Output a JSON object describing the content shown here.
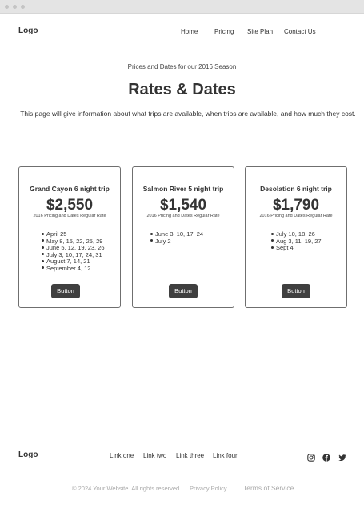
{
  "header": {
    "logo": "Logo",
    "nav": [
      {
        "label": "Home"
      },
      {
        "label": "Pricing"
      },
      {
        "label": "Site Plan"
      },
      {
        "label": "Contact Us"
      }
    ]
  },
  "hero": {
    "eyebrow": "Prices and Dates for our 2016 Season",
    "title": "Rates & Dates",
    "intro": "This page will give information about what trips are available, when trips are available, and how much they cost."
  },
  "cards": [
    {
      "title": "Grand Cayon 6 night trip",
      "price": "$2,550",
      "note": "2016 Pricing and Dates Regular Rate",
      "dates": [
        "April 25",
        "May 8, 15, 22, 25, 29",
        "June 5, 12, 19, 23, 26",
        "July 3, 10, 17, 24, 31",
        "August 7, 14, 21",
        "September 4, 12"
      ],
      "button": "Button"
    },
    {
      "title": "Salmon River 5 night trip",
      "price": "$1,540",
      "note": "2016 Pricing and Dates Regular Rate",
      "dates": [
        "June 3, 10, 17, 24",
        "July 2"
      ],
      "button": "Button"
    },
    {
      "title": "Desolation 6 night trip",
      "price": "$1,790",
      "note": "2016 Pricing and Dates Regular Rate",
      "dates": [
        "July 10, 18, 26",
        "Aug 3, 11, 19, 27",
        "Sept 4"
      ],
      "button": "Button"
    }
  ],
  "footer": {
    "logo": "Logo",
    "links": [
      {
        "label": "Link one"
      },
      {
        "label": "Link two"
      },
      {
        "label": "Link three"
      },
      {
        "label": "Link four"
      }
    ],
    "social_icons": [
      "instagram-icon",
      "facebook-icon",
      "twitter-icon"
    ],
    "copyright": "© 2024 Your Website. All rights reserved.",
    "privacy": "Privacy Policy",
    "terms": "Terms of Service"
  }
}
